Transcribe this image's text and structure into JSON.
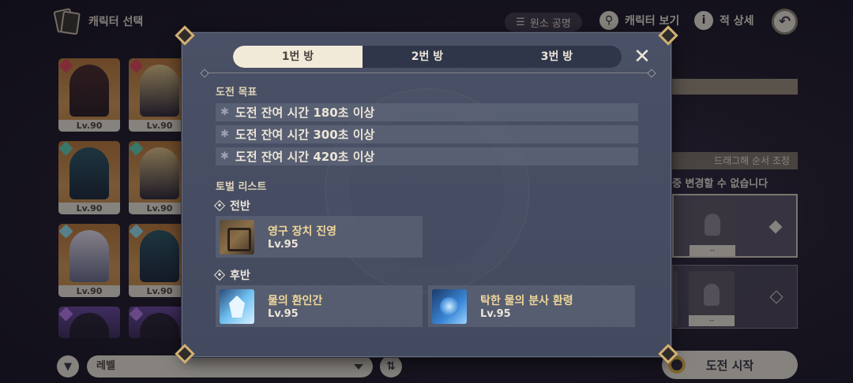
{
  "header": {
    "title": "캐릭터 선택",
    "element_resonance": "원소 공명",
    "view_characters": "캐릭터 보기",
    "enemy_details": "적 상세"
  },
  "characters": [
    {
      "level": "Lv.90",
      "element": "pyro"
    },
    {
      "level": "Lv.90",
      "element": "pyro"
    },
    {
      "level": "Lv.90",
      "element": "anemo"
    },
    {
      "level": "Lv.90",
      "element": "anemo"
    },
    {
      "level": "Lv.90",
      "element": "cryo"
    },
    {
      "level": "Lv.90",
      "element": "cryo"
    },
    {
      "level": "",
      "element": "electro"
    },
    {
      "level": "",
      "element": "electro"
    }
  ],
  "right_panel": {
    "drag_hint": "드래그해 순서 조정",
    "cannot_change": "중 변경할 수 없습니다",
    "slot_dash": "--"
  },
  "bottom_bar": {
    "sort_value": "레벨",
    "start_label": "도전 시작"
  },
  "modal": {
    "tabs": [
      {
        "label": "1번 방",
        "active": true
      },
      {
        "label": "2번 방",
        "active": false
      },
      {
        "label": "3번 방",
        "active": false
      }
    ],
    "challenge_title": "도전 목표",
    "goals": [
      "도전 잔여 시간 180초 이상",
      "도전 잔여 시간 300초 이상",
      "도전 잔여 시간 420초 이상"
    ],
    "enemy_list_title": "토벌 리스트",
    "first_half": {
      "label": "전반",
      "enemies": [
        {
          "name": "영구 장치 진영",
          "level": "Lv.95",
          "icon": "ruin-machine-icon"
        }
      ]
    },
    "second_half": {
      "label": "후반",
      "enemies": [
        {
          "name": "물의 환인간",
          "level": "Lv.95",
          "icon": "hydro-mimic-icon"
        },
        {
          "name": "탁한 물의 분사 환령",
          "level": "Lv.95",
          "icon": "hydro-phantasm-icon"
        }
      ]
    }
  },
  "colors": {
    "modal_bg": "#4a5065",
    "tab_active": "#f2ead8",
    "enemy_name": "#f0d79a",
    "corner_gold": "#d2b072"
  }
}
